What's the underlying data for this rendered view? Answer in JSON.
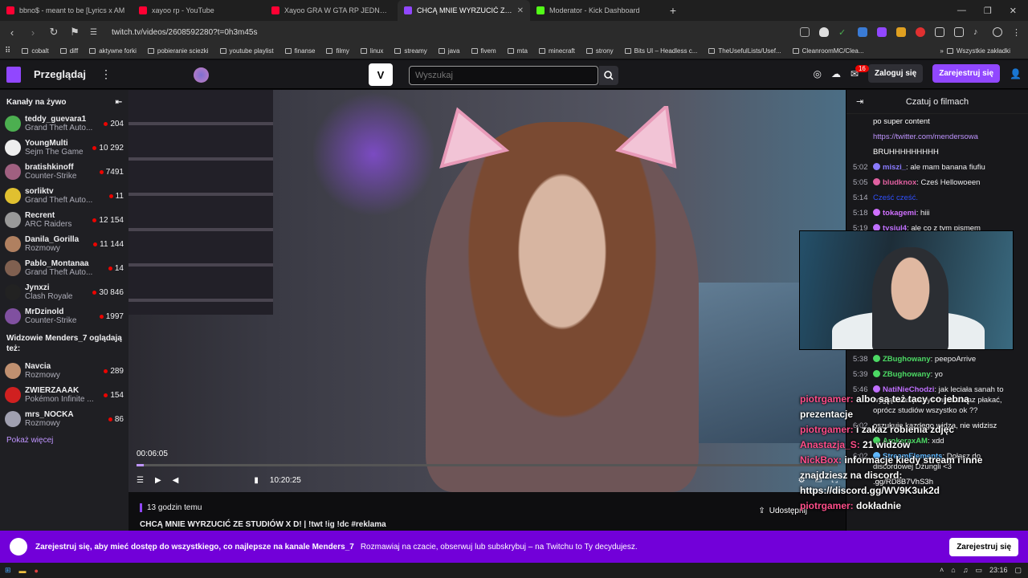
{
  "browser": {
    "tabs": [
      {
        "title": "bbno$ - meant to be [Lyrics x AM",
        "color": "#ff0033"
      },
      {
        "title": "xayoo rp - YouTube",
        "color": "#ff0033"
      },
      {
        "title": "Xayoo GRA W GTA RP JEDNA WIELK",
        "color": "#ff0033"
      },
      {
        "title": "CHCĄ MNIE WYRZUCIĆ ZE STUDI",
        "color": "#9147ff",
        "active": true
      },
      {
        "title": "Moderator - Kick Dashboard",
        "color": "#53fc18"
      }
    ],
    "new_tab": "+",
    "url": "twitch.tv/videos/2608592280?t=0h3m45s",
    "bookmarks": [
      "cobalt",
      "diff",
      "aktywne forki",
      "pobieranie sciezki",
      "youtube playlist",
      "finanse",
      "filmy",
      "linux",
      "streamy",
      "java",
      "fivem",
      "mta",
      "minecraft",
      "strony",
      "Bits UI – Headless c...",
      "TheUsefulLists/Usef...",
      "CleanroomMC/Clea..."
    ],
    "bookmarks_all": "Wszystkie zakładki",
    "bookmarks_more": "»"
  },
  "twitch": {
    "browse": "Przeglądaj",
    "search_placeholder": "Wyszukaj",
    "notif_count": "16",
    "login": "Zaloguj się",
    "signup": "Zarejestruj się"
  },
  "sidebar": {
    "live_header": "Kanały na żywo",
    "live": [
      {
        "name": "teddy_guevara1",
        "game": "Grand Theft Auto...",
        "viewers": "204",
        "color": "#4caf50"
      },
      {
        "name": "YoungMulti",
        "game": "Sejm The Game",
        "viewers": "10 292",
        "color": "#eee"
      },
      {
        "name": "bratishkinoff",
        "game": "Counter-Strike",
        "viewers": "7491",
        "color": "#a06080"
      },
      {
        "name": "sorliktv",
        "game": "Grand Theft Auto...",
        "viewers": "11",
        "color": "#e0c030"
      },
      {
        "name": "Recrent",
        "game": "ARC Raiders",
        "viewers": "12 154",
        "color": "#999"
      },
      {
        "name": "Danila_Gorilla",
        "game": "Rozmowy",
        "viewers": "11 144",
        "color": "#b08060"
      },
      {
        "name": "Pablo_Montanaa",
        "game": "Grand Theft Auto...",
        "viewers": "14",
        "color": "#806050"
      },
      {
        "name": "Jynxzi",
        "game": "Clash Royale",
        "viewers": "30 846",
        "color": "#222"
      },
      {
        "name": "MrDzinold",
        "game": "Counter-Strike",
        "viewers": "1997",
        "color": "#8050a0"
      }
    ],
    "also_header": "Widzowie Menders_7 oglądają też:",
    "also": [
      {
        "name": "Navcia",
        "game": "Rozmowy",
        "viewers": "289",
        "color": "#c09070"
      },
      {
        "name": "ZWIERZAAAK",
        "game": "Pokémon Infinite ...",
        "viewers": "154",
        "color": "#d02020"
      },
      {
        "name": "mrs_NOCKA",
        "game": "Rozmowy",
        "viewers": "86",
        "color": "#a0a0b0"
      }
    ],
    "show_more": "Pokaż więcej"
  },
  "player": {
    "current_time": "00:06:05",
    "duration": "10:20:25",
    "progress_fraction": 0.0098
  },
  "video_info": {
    "ago": "13 godzin temu",
    "title": "CHCĄ MNIE WYRZUCIĆ ZE STUDIÓW X D! | !twt !ig !dc #reklama",
    "share": "Udostępnij"
  },
  "chat": {
    "header": "Czatuj o filmach",
    "messages_top": [
      {
        "time": "",
        "user": "",
        "color": "#fff",
        "text": "po super content"
      },
      {
        "time": "",
        "user": "",
        "color": "#bf94ff",
        "text": "https://twitter.com/mendersowa"
      },
      {
        "time": "",
        "user": "",
        "color": "#fff",
        "text": "BRUHHHHHHHHH"
      },
      {
        "time": "5:02",
        "user": "miszi_",
        "color": "#8a7bff",
        "text": "ale mam banana fiufiu"
      },
      {
        "time": "5:05",
        "user": "bludknox",
        "color": "#e060a0",
        "text": "Cześ Hellowoeen"
      },
      {
        "time": "5:14",
        "user": "",
        "color": "#3050ff",
        "text": "Cześć cześć."
      },
      {
        "time": "5:18",
        "user": "tokagemi",
        "color": "#d070ff",
        "text": "hiii"
      },
      {
        "time": "5:19",
        "user": "tysiul4",
        "color": "#c070ff",
        "text": "ale co z tym pismem"
      }
    ],
    "messages_bottom": [
      {
        "time": "5:38",
        "user": "ZBughowany",
        "color": "#4cd964",
        "text": "peepoArrive"
      },
      {
        "time": "5:39",
        "user": "ZBughowany",
        "color": "#4cd964",
        "text": "yo"
      },
      {
        "time": "5:46",
        "user": "NatiNieChodzi",
        "color": "#c070ff",
        "text": "jak leciała sanah to wyglądałaś jakbyś miała zaraz płakać, oprócz studiów wszystko ok ??"
      },
      {
        "time": "6:02",
        "user": "",
        "color": "#fff",
        "text": "oszukuje kazdego widza, nie widzisz"
      },
      {
        "time": "",
        "user": "ArokeraxAM",
        "color": "#4cd964",
        "text": "xdd"
      },
      {
        "time": "6:02",
        "user": "StreamElements",
        "color": "#5fb8ff",
        "text": "Dołącz do discordowej Dżungli <3"
      },
      {
        "time": "",
        "user": "",
        "color": "#fff",
        "text": ".gg/RD8B7VhS3h"
      }
    ]
  },
  "overlay_chat": [
    {
      "name": "piotrgamer:",
      "text": "albo są też tacy co jebną prezentacje"
    },
    {
      "name": "piotrgamer:",
      "text": "i zakaz robienia zdjęć"
    },
    {
      "name": "Anastazja_S:",
      "text": "21 widzów"
    },
    {
      "name": "NickBox:",
      "text": "informacje kiedy stream i inne znajdziesz na discord: https://discord.gg/WV9K3uk2d"
    },
    {
      "name": "piotrgamer:",
      "text": "dokładnie"
    }
  ],
  "banner": {
    "lead": "Zarejestruj się, aby mieć dostęp do wszystkiego, co najlepsze na kanale Menders_7",
    "text": "Rozmawiaj na czacie, obserwuj lub subskrybuj – na Twitchu to Ty decydujesz.",
    "button": "Zarejestruj się"
  },
  "taskbar": {
    "time": "23:16"
  }
}
